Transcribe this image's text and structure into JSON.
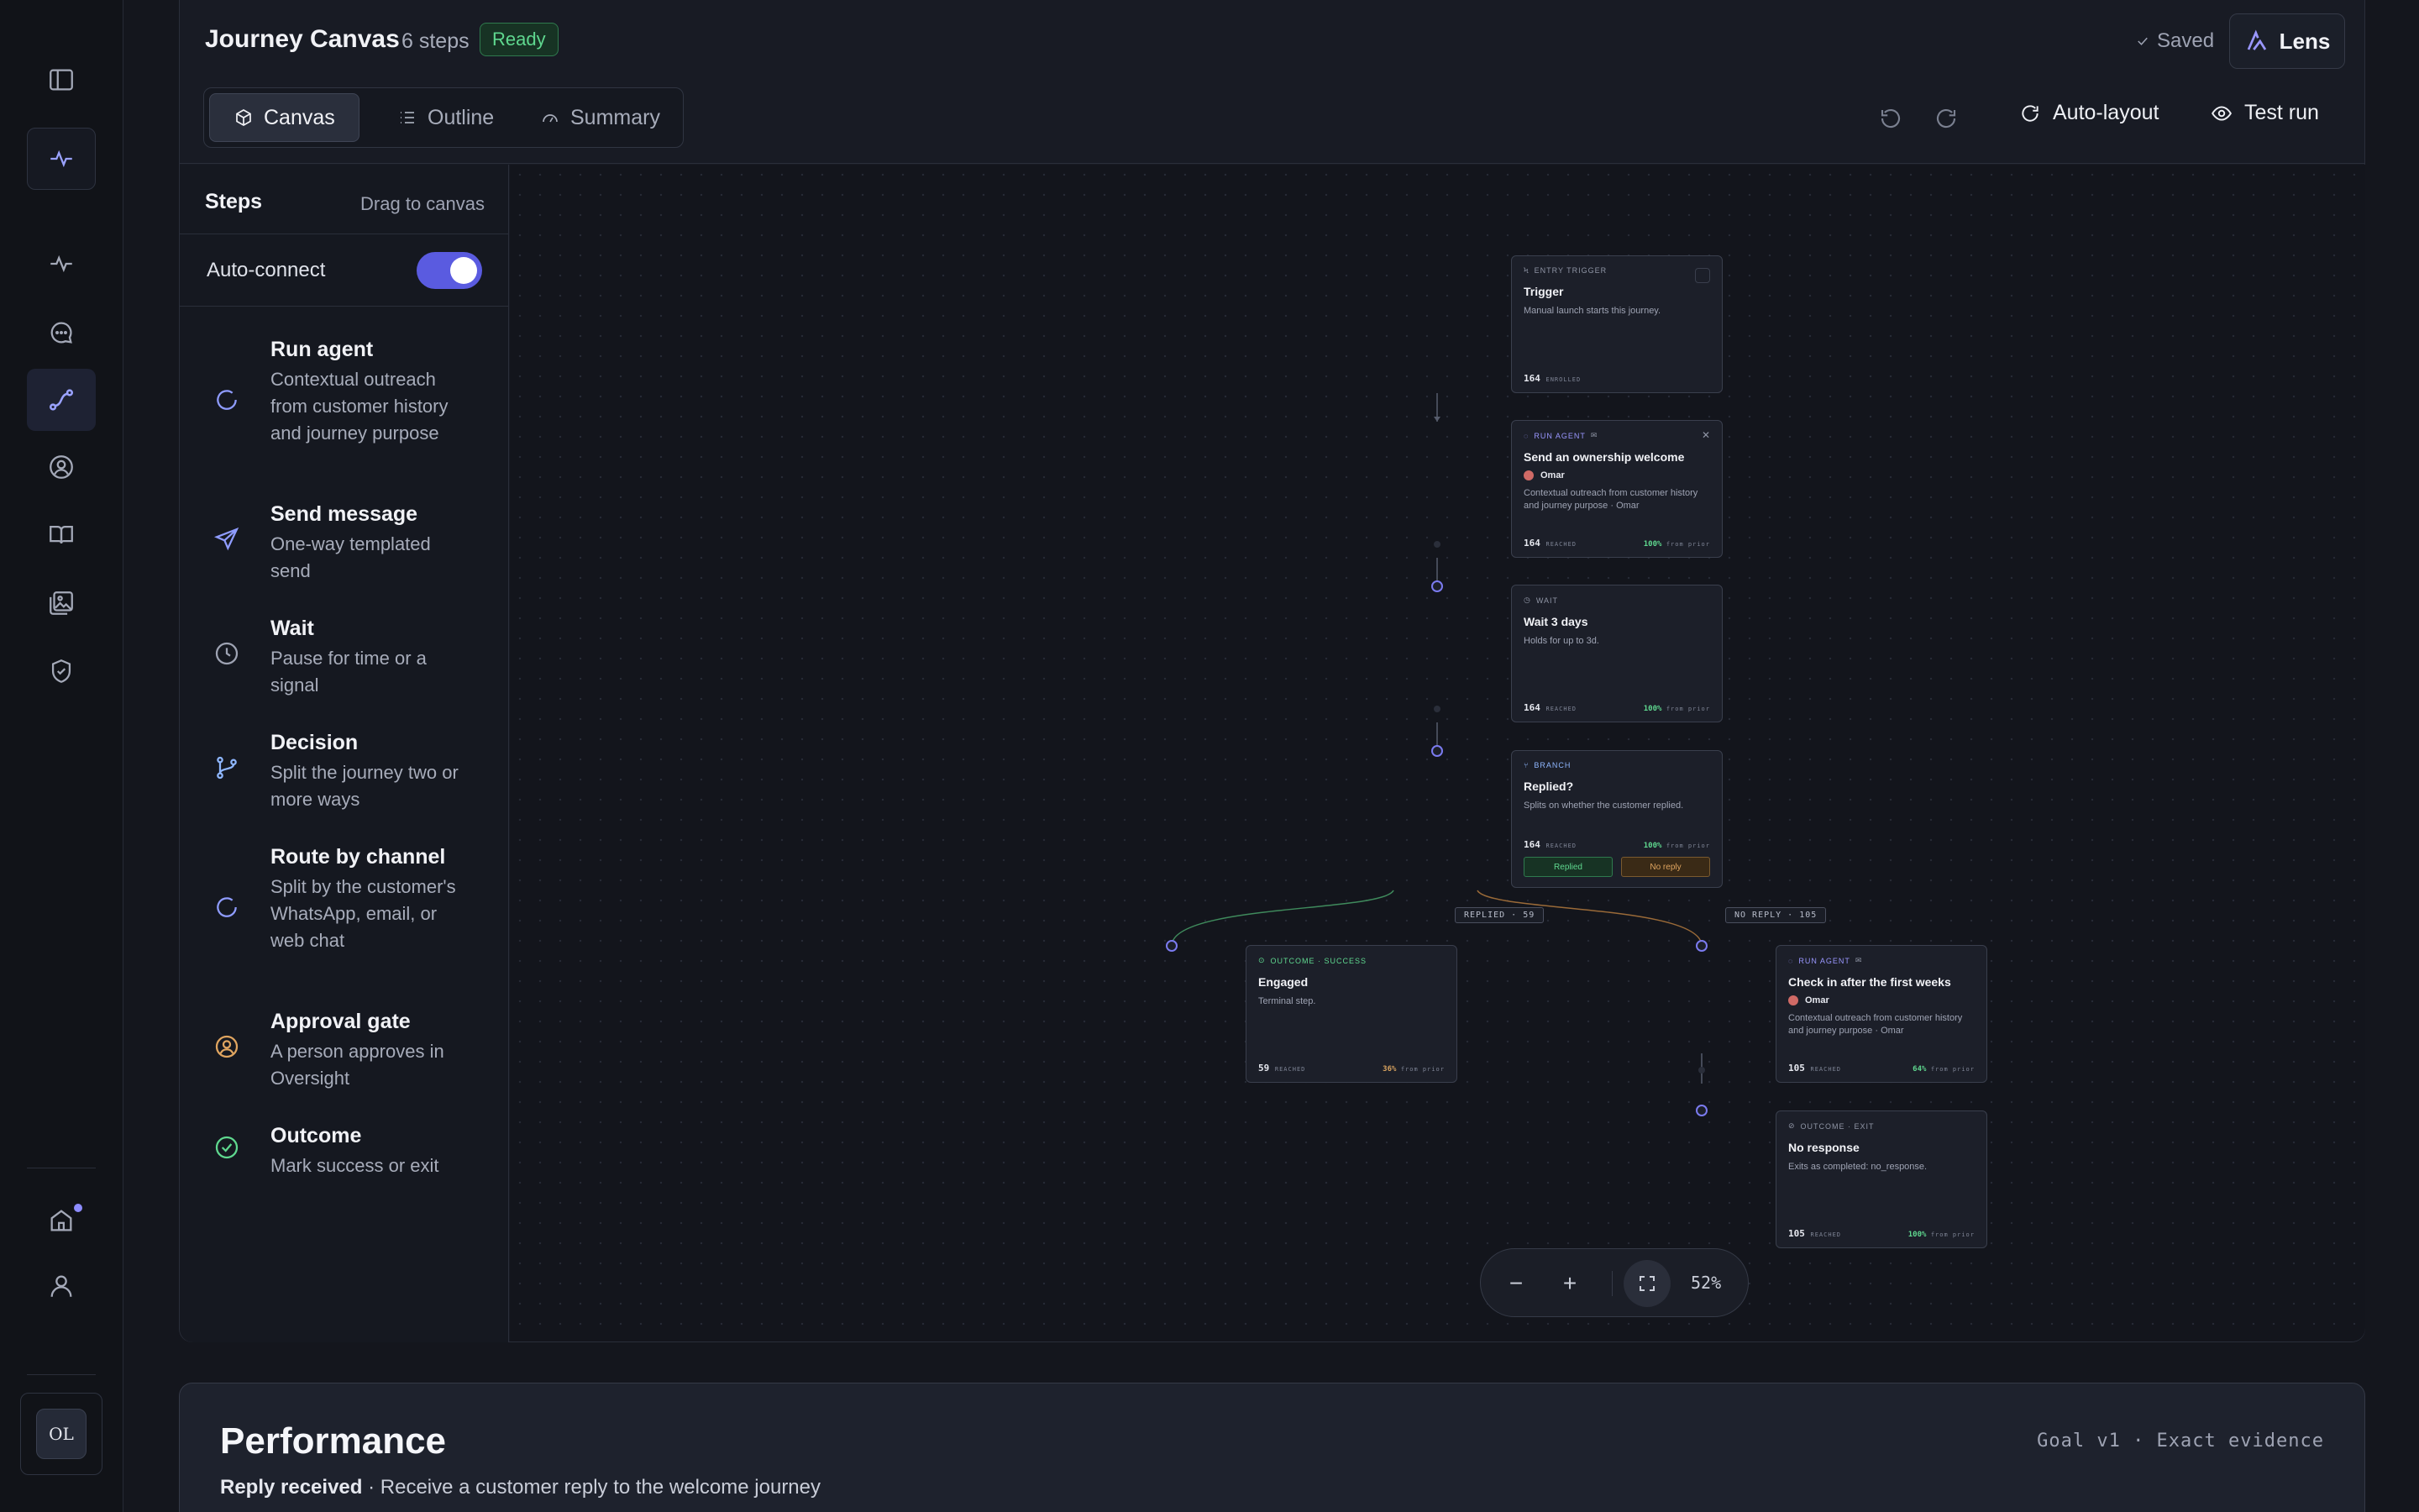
{
  "header": {
    "title": "Journey Canvas",
    "steps_count": "6 steps",
    "status": "Ready",
    "saved": "Saved",
    "lens": "Lens",
    "tabs": [
      "Canvas",
      "Outline",
      "Summary"
    ],
    "auto_layout": "Auto-layout",
    "test_run": "Test run"
  },
  "sidebar": {
    "title": "Steps",
    "hint": "Drag to canvas",
    "auto_connect": "Auto-connect",
    "auto_connect_on": true,
    "items": [
      {
        "name": "Run agent",
        "desc": "Contextual outreach from customer history and journey purpose",
        "icon": "agent-icon",
        "color": "#8f9cff"
      },
      {
        "name": "Send message",
        "desc": "One-way templated send",
        "icon": "send-icon",
        "color": "#8f9cff"
      },
      {
        "name": "Wait",
        "desc": "Pause for time or a signal",
        "icon": "clock-icon",
        "color": "#9ea3b3"
      },
      {
        "name": "Decision",
        "desc": "Split the journey two or more ways",
        "icon": "branch-icon",
        "color": "#8fb7ff"
      },
      {
        "name": "Route by channel",
        "desc": "Split by the customer's WhatsApp, email, or web chat",
        "icon": "route-icon",
        "color": "#8f9cff"
      },
      {
        "name": "Approval gate",
        "desc": "A person approves in Oversight",
        "icon": "person-icon",
        "color": "#e0a560"
      },
      {
        "name": "Outcome",
        "desc": "Mark success or exit",
        "icon": "check-circle-icon",
        "color": "#5fd88f"
      }
    ]
  },
  "canvas": {
    "nodes": {
      "trigger": {
        "kicker": "Entry trigger",
        "title": "Trigger",
        "desc": "Manual launch starts this journey.",
        "metric": "164",
        "metric_label": "ENROLLED"
      },
      "welcome": {
        "kicker": "Run agent",
        "title": "Send an ownership welcome",
        "owner": "Omar",
        "desc": "Contextual outreach from customer history and journey purpose · Omar",
        "metric": "164",
        "metric_label": "REACHED",
        "side": "100%",
        "side_label": "from prior"
      },
      "wait": {
        "kicker": "Wait",
        "title": "Wait 3 days",
        "desc": "Holds for up to 3d.",
        "metric": "164",
        "metric_label": "REACHED",
        "side": "100%",
        "side_label": "from prior"
      },
      "branch": {
        "kicker": "Branch",
        "title": "Replied?",
        "desc": "Splits on whether the customer replied.",
        "metric": "164",
        "metric_label": "REACHED",
        "side": "100%",
        "side_label": "from prior",
        "yes": "Replied",
        "no": "No reply"
      },
      "engaged": {
        "kicker": "Outcome · Success",
        "title": "Engaged",
        "desc": "Terminal step.",
        "metric": "59",
        "metric_label": "REACHED",
        "side": "36%",
        "side_label": "from prior"
      },
      "checkin": {
        "kicker": "Run agent",
        "title": "Check in after the first weeks",
        "owner": "Omar",
        "desc": "Contextual outreach from customer history and journey purpose · Omar",
        "metric": "105",
        "metric_label": "REACHED",
        "side": "64%",
        "side_label": "from prior"
      },
      "noresp": {
        "kicker": "Outcome · Exit",
        "title": "No response",
        "desc": "Exits as completed: no_response.",
        "metric": "105",
        "metric_label": "REACHED",
        "side": "100%",
        "side_label": "from prior"
      }
    },
    "edge_labels": {
      "replied": "REPLIED · 59",
      "noreply": "NO REPLY · 105"
    },
    "zoom": "52%"
  },
  "performance": {
    "title": "Performance",
    "goal_name": "Reply received",
    "goal_desc": " · Receive a customer reply to the welcome journey",
    "goal_meta": "Goal v1 · Exact evidence"
  }
}
